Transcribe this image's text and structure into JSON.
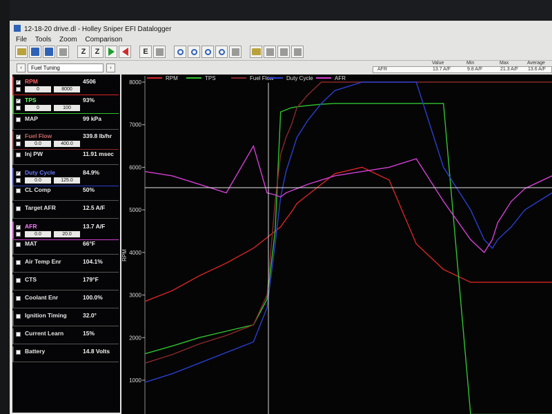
{
  "window": {
    "title": "12-18-20 drive.dl - Holley Sniper EFI Datalogger"
  },
  "menu": [
    "File",
    "Tools",
    "Zoom",
    "Comparison"
  ],
  "toolbar": [
    {
      "icon": "open-folder-icon"
    },
    {
      "icon": "save-icon"
    },
    {
      "icon": "save-as-icon"
    },
    {
      "icon": "export-icon"
    },
    {
      "icon": "zoom-all-icon",
      "label": "Z"
    },
    {
      "icon": "zoom-icon",
      "label": "Z"
    },
    {
      "icon": "play-forward-icon"
    },
    {
      "icon": "play-back-icon"
    },
    {
      "icon": "event-icon",
      "label": "E"
    },
    {
      "icon": "grid-icon"
    },
    {
      "icon": "zoom-in-icon"
    },
    {
      "icon": "zoom-out-icon"
    },
    {
      "icon": "zoom-fit-icon"
    },
    {
      "icon": "zoom-reset-icon"
    },
    {
      "icon": "channels-icon"
    },
    {
      "icon": "folder-icon"
    },
    {
      "icon": "compare-icon"
    },
    {
      "icon": "overlay-icon"
    },
    {
      "icon": "layer-icon"
    }
  ],
  "summary": {
    "headers": {
      "value": "Value",
      "min": "Min",
      "max": "Max",
      "average": "Average"
    },
    "row": {
      "name": "AFR",
      "value": "13.7 A/F",
      "min": "9.8 A/F",
      "max": "21.3 A/F",
      "average": "13.6 A/F"
    }
  },
  "panel": {
    "prev": "‹",
    "next": "›",
    "group": "Fuel Tuning",
    "gauges": [
      {
        "name": "RPM",
        "value": "4506",
        "checked": true,
        "range": [
          "0",
          "8000"
        ],
        "color": "#d92424"
      },
      {
        "name": "TPS",
        "value": "93%",
        "checked": true,
        "range": [
          "0",
          "100"
        ],
        "color": "#2fc52f"
      },
      {
        "name": "MAP",
        "value": "99 kPa",
        "checked": false,
        "color": "#555555"
      },
      {
        "name": "Fuel Flow",
        "value": "339.8 lb/hr",
        "checked": true,
        "range": [
          "0.0",
          "400.0"
        ],
        "color": "#8a2a2a"
      },
      {
        "name": "Inj PW",
        "value": "11.91 msec",
        "checked": false,
        "color": "#555555"
      },
      {
        "name": "Duty Cycle",
        "value": "84.9%",
        "checked": true,
        "range": [
          "0.0",
          "125.0"
        ],
        "color": "#2a3fd0"
      },
      {
        "name": "CL Comp",
        "value": "50%",
        "checked": false,
        "color": "#555555"
      },
      {
        "name": "Target AFR",
        "value": "12.5 A/F",
        "checked": false,
        "color": "#555555"
      },
      {
        "name": "AFR",
        "value": "13.7 A/F",
        "checked": true,
        "range": [
          "0.0",
          "20.0"
        ],
        "color": "#d43fd4"
      },
      {
        "name": "MAT",
        "value": "66°F",
        "checked": false,
        "color": "#555555"
      },
      {
        "name": "Air Temp Enr",
        "value": "104.1%",
        "checked": false,
        "color": "#555555"
      },
      {
        "name": "CTS",
        "value": "179°F",
        "checked": false,
        "color": "#555555"
      },
      {
        "name": "Coolant Enr",
        "value": "100.0%",
        "checked": false,
        "color": "#555555"
      },
      {
        "name": "Ignition Timing",
        "value": "32.0°",
        "checked": false,
        "color": "#555555"
      },
      {
        "name": "Current Learn",
        "value": "15%",
        "checked": false,
        "color": "#555555"
      },
      {
        "name": "Battery",
        "value": "14.8 Volts",
        "checked": false,
        "color": "#555555"
      }
    ]
  },
  "chart_data": {
    "type": "line",
    "ylabel": "RPM",
    "ylim": [
      0,
      8000
    ],
    "y_ticks": [
      1000,
      2000,
      3000,
      4000,
      5000,
      6000,
      7000,
      8000
    ],
    "grid": false,
    "legend": "top",
    "x": [
      0,
      10,
      20,
      30,
      40,
      45,
      48,
      50,
      52,
      54,
      56,
      60,
      65,
      70,
      80,
      90,
      100,
      110,
      120,
      125,
      128,
      130,
      135,
      140,
      150
    ],
    "series": [
      {
        "name": "RPM",
        "color": "#d92424",
        "values": [
          2850,
          3100,
          3450,
          3750,
          4100,
          4350,
          4500,
          4600,
          4780,
          4950,
          5150,
          5350,
          5600,
          5850,
          6000,
          5700,
          4200,
          3600,
          3300,
          3300,
          3300,
          3300,
          3300,
          3300,
          3300
        ]
      },
      {
        "name": "TPS",
        "color": "#2fc52f",
        "values": [
          1620,
          1800,
          2000,
          2150,
          2300,
          2900,
          4500,
          7300,
          7350,
          7400,
          7420,
          7450,
          7480,
          7500,
          7500,
          7500,
          7500,
          7500,
          200,
          200,
          200,
          200,
          200,
          200,
          200
        ]
      },
      {
        "name": "Fuel Flow",
        "color": "#8a2a2a",
        "values": [
          1400,
          1600,
          1850,
          2050,
          2300,
          3000,
          5200,
          6300,
          6700,
          7000,
          7400,
          7700,
          8000,
          8000,
          8000,
          8000,
          8000,
          8000,
          8000,
          8000,
          8000,
          8000,
          8000,
          8000,
          8000
        ]
      },
      {
        "name": "Duty Cycle",
        "color": "#2a3fd0",
        "values": [
          950,
          1150,
          1400,
          1650,
          1900,
          2700,
          4200,
          5300,
          5900,
          6300,
          6700,
          7100,
          7500,
          7800,
          8000,
          8000,
          8000,
          6000,
          5000,
          4300,
          4100,
          4300,
          4600,
          5000,
          5400
        ]
      },
      {
        "name": "AFR",
        "color": "#d43fd4",
        "values": [
          5900,
          5800,
          5600,
          5400,
          6500,
          5400,
          5350,
          5300,
          5400,
          5450,
          5500,
          5600,
          5700,
          5800,
          5900,
          6000,
          6200,
          5200,
          4300,
          4000,
          4300,
          4700,
          5200,
          5500,
          5800
        ]
      }
    ]
  }
}
